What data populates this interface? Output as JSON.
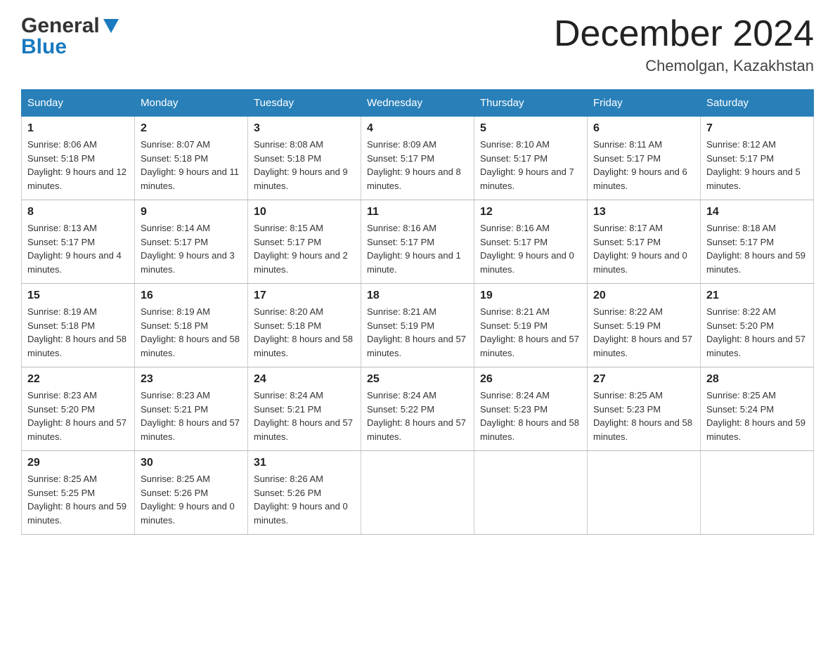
{
  "header": {
    "logo_general": "General",
    "logo_blue": "Blue",
    "title": "December 2024",
    "location": "Chemolgan, Kazakhstan"
  },
  "calendar": {
    "days_of_week": [
      "Sunday",
      "Monday",
      "Tuesday",
      "Wednesday",
      "Thursday",
      "Friday",
      "Saturday"
    ],
    "weeks": [
      [
        {
          "day": "1",
          "sunrise": "8:06 AM",
          "sunset": "5:18 PM",
          "daylight": "9 hours and 12 minutes."
        },
        {
          "day": "2",
          "sunrise": "8:07 AM",
          "sunset": "5:18 PM",
          "daylight": "9 hours and 11 minutes."
        },
        {
          "day": "3",
          "sunrise": "8:08 AM",
          "sunset": "5:18 PM",
          "daylight": "9 hours and 9 minutes."
        },
        {
          "day": "4",
          "sunrise": "8:09 AM",
          "sunset": "5:17 PM",
          "daylight": "9 hours and 8 minutes."
        },
        {
          "day": "5",
          "sunrise": "8:10 AM",
          "sunset": "5:17 PM",
          "daylight": "9 hours and 7 minutes."
        },
        {
          "day": "6",
          "sunrise": "8:11 AM",
          "sunset": "5:17 PM",
          "daylight": "9 hours and 6 minutes."
        },
        {
          "day": "7",
          "sunrise": "8:12 AM",
          "sunset": "5:17 PM",
          "daylight": "9 hours and 5 minutes."
        }
      ],
      [
        {
          "day": "8",
          "sunrise": "8:13 AM",
          "sunset": "5:17 PM",
          "daylight": "9 hours and 4 minutes."
        },
        {
          "day": "9",
          "sunrise": "8:14 AM",
          "sunset": "5:17 PM",
          "daylight": "9 hours and 3 minutes."
        },
        {
          "day": "10",
          "sunrise": "8:15 AM",
          "sunset": "5:17 PM",
          "daylight": "9 hours and 2 minutes."
        },
        {
          "day": "11",
          "sunrise": "8:16 AM",
          "sunset": "5:17 PM",
          "daylight": "9 hours and 1 minute."
        },
        {
          "day": "12",
          "sunrise": "8:16 AM",
          "sunset": "5:17 PM",
          "daylight": "9 hours and 0 minutes."
        },
        {
          "day": "13",
          "sunrise": "8:17 AM",
          "sunset": "5:17 PM",
          "daylight": "9 hours and 0 minutes."
        },
        {
          "day": "14",
          "sunrise": "8:18 AM",
          "sunset": "5:17 PM",
          "daylight": "8 hours and 59 minutes."
        }
      ],
      [
        {
          "day": "15",
          "sunrise": "8:19 AM",
          "sunset": "5:18 PM",
          "daylight": "8 hours and 58 minutes."
        },
        {
          "day": "16",
          "sunrise": "8:19 AM",
          "sunset": "5:18 PM",
          "daylight": "8 hours and 58 minutes."
        },
        {
          "day": "17",
          "sunrise": "8:20 AM",
          "sunset": "5:18 PM",
          "daylight": "8 hours and 58 minutes."
        },
        {
          "day": "18",
          "sunrise": "8:21 AM",
          "sunset": "5:19 PM",
          "daylight": "8 hours and 57 minutes."
        },
        {
          "day": "19",
          "sunrise": "8:21 AM",
          "sunset": "5:19 PM",
          "daylight": "8 hours and 57 minutes."
        },
        {
          "day": "20",
          "sunrise": "8:22 AM",
          "sunset": "5:19 PM",
          "daylight": "8 hours and 57 minutes."
        },
        {
          "day": "21",
          "sunrise": "8:22 AM",
          "sunset": "5:20 PM",
          "daylight": "8 hours and 57 minutes."
        }
      ],
      [
        {
          "day": "22",
          "sunrise": "8:23 AM",
          "sunset": "5:20 PM",
          "daylight": "8 hours and 57 minutes."
        },
        {
          "day": "23",
          "sunrise": "8:23 AM",
          "sunset": "5:21 PM",
          "daylight": "8 hours and 57 minutes."
        },
        {
          "day": "24",
          "sunrise": "8:24 AM",
          "sunset": "5:21 PM",
          "daylight": "8 hours and 57 minutes."
        },
        {
          "day": "25",
          "sunrise": "8:24 AM",
          "sunset": "5:22 PM",
          "daylight": "8 hours and 57 minutes."
        },
        {
          "day": "26",
          "sunrise": "8:24 AM",
          "sunset": "5:23 PM",
          "daylight": "8 hours and 58 minutes."
        },
        {
          "day": "27",
          "sunrise": "8:25 AM",
          "sunset": "5:23 PM",
          "daylight": "8 hours and 58 minutes."
        },
        {
          "day": "28",
          "sunrise": "8:25 AM",
          "sunset": "5:24 PM",
          "daylight": "8 hours and 59 minutes."
        }
      ],
      [
        {
          "day": "29",
          "sunrise": "8:25 AM",
          "sunset": "5:25 PM",
          "daylight": "8 hours and 59 minutes."
        },
        {
          "day": "30",
          "sunrise": "8:25 AM",
          "sunset": "5:26 PM",
          "daylight": "9 hours and 0 minutes."
        },
        {
          "day": "31",
          "sunrise": "8:26 AM",
          "sunset": "5:26 PM",
          "daylight": "9 hours and 0 minutes."
        },
        null,
        null,
        null,
        null
      ]
    ]
  }
}
